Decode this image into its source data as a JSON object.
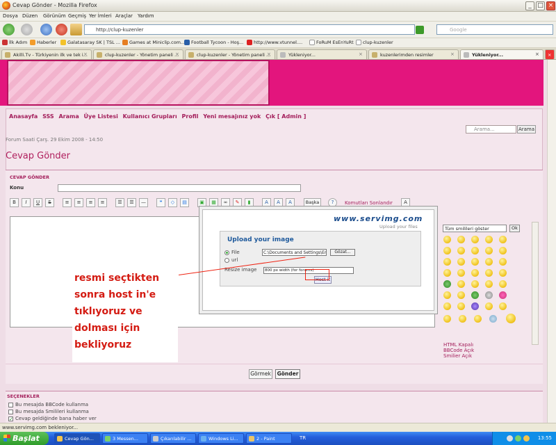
{
  "window": {
    "title": "Cevap Gönder - Mozilla Firefox"
  },
  "menu": [
    "Dosya",
    "Düzen",
    "Görünüm",
    "Geçmiş",
    "Yer İmleri",
    "Araçlar",
    "Yardım"
  ],
  "nav": {
    "url": "http://clup-kuzenler",
    "search_placeholder": "Google"
  },
  "bookmarks": [
    "İlk Adım",
    "Haberler",
    "Galatasaray SK | TSL ...",
    "Games at Miniclip.com...",
    "Football Tycoon - Hoş...",
    "http://www.vtunnel....",
    "FoRuM EsEnYuRt",
    "clup-kuzenler"
  ],
  "tabs": [
    "Akilli.Tv - Türkiyenin ilk ve tek i...",
    "clup-kuzenler - Yönetim paneli ...",
    "clup-kuzenler - Yönetim paneli ...",
    "Yükleniyor...",
    "kuzenlerimden resimler",
    "Yükleniyor..."
  ],
  "forum": {
    "links": [
      "Anasayfa",
      "SSS",
      "Arama",
      "Üye Listesi",
      "Kullanıcı Grupları",
      "Profil",
      "Yeni mesajınız yok",
      "Çık [ Admin ]"
    ],
    "search_placeholder": "Arama...",
    "search_button": "Arama",
    "time": "Forum Saati Çarş. 29 Ekim 2008 - 14:50",
    "heading": "Cevap Gönder",
    "section": "CEVAP GÖNDER",
    "subject_label": "Konu",
    "other_button": "Başka",
    "toolbar_link": "Komutları Sonlandır",
    "smiley_select": "Tüm smilileri göster",
    "smiley_ok": "Ok",
    "smiley_links": [
      "HTML Kapalı",
      "BBCode Açık",
      "Smilier Açık"
    ],
    "preview_button": "Görmek",
    "submit_button": "Gönder",
    "options_heading": "SEÇENEKLER",
    "options": [
      "Bu mesajda BBCode kullanma",
      "Bu mesajda Smilileri kullanma",
      "Cevap geldiğinde bana haber ver"
    ]
  },
  "upload": {
    "logo": "www.servimg.com",
    "logo_sub": "Upload your files",
    "title": "Upload your image",
    "file_label": "File",
    "file_value": "C:\\Documents and Settings\\Eren\\Deskt",
    "browse": "Gözat...",
    "url_label": "url",
    "resize_label": "Resize image",
    "resize_value": "800 px width (for forums)",
    "host_button": "Host it"
  },
  "annotation": {
    "lines": [
      "resmi seçtikten",
      "sonra host in'e",
      "tıklıyoruz ve",
      "dolması için",
      "bekliyoruz"
    ]
  },
  "status": "www.servimg.com bekleniyor...",
  "taskbar": {
    "start": "Başlat",
    "tasks": [
      "Cevap Gön...",
      "3 Messen...",
      "Çıkarılabilir ...",
      "Windows Li...",
      "2 - Paint"
    ],
    "lang": "TR",
    "clock": "13:55"
  }
}
